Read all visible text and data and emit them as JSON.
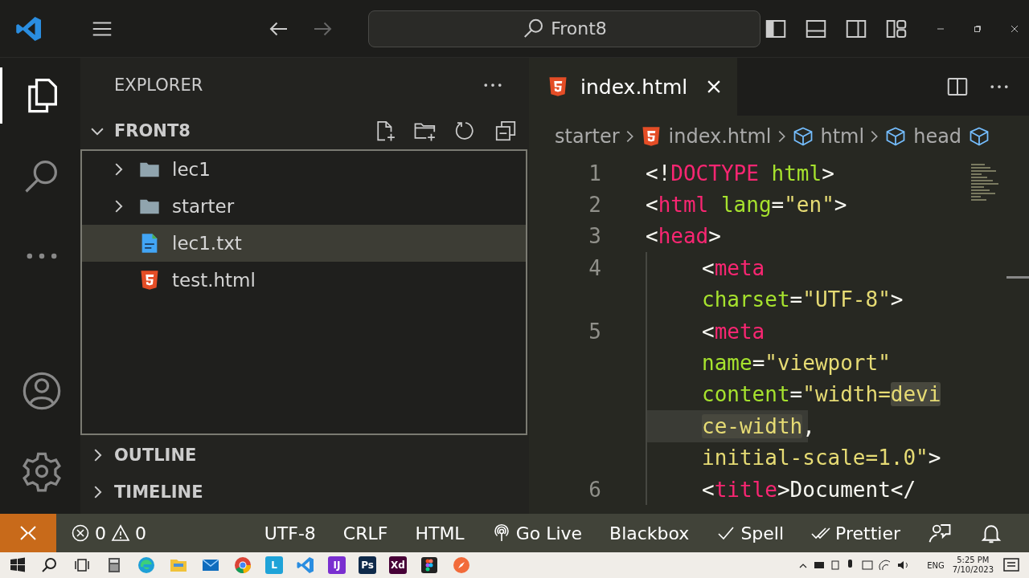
{
  "title_bar": {
    "search": "Front8"
  },
  "activity_bar": [
    {
      "kind": "files",
      "selected": true
    },
    {
      "kind": "search",
      "selected": false
    },
    {
      "kind": "more",
      "selected": false
    }
  ],
  "activity_bottom": [
    {
      "kind": "account"
    },
    {
      "kind": "settings"
    }
  ],
  "sidebar": {
    "title": "EXPLORER",
    "folder": {
      "name": "FRONT8",
      "expanded": true
    },
    "items": [
      {
        "name": "lec1",
        "kind": "folder",
        "expanded": false,
        "selected": false
      },
      {
        "name": "starter",
        "kind": "folder",
        "expanded": false,
        "selected": false
      },
      {
        "name": "lec1.txt",
        "kind": "text-file",
        "selected": true
      },
      {
        "name": "test.html",
        "kind": "html-file",
        "selected": false
      }
    ],
    "sections": [
      {
        "name": "OUTLINE",
        "expanded": false
      },
      {
        "name": "TIMELINE",
        "expanded": false
      }
    ]
  },
  "editor": {
    "tabs": [
      {
        "name": "index.html",
        "selected": true
      }
    ],
    "breadcrumbs": [
      {
        "text": "starter",
        "kind": "folder"
      },
      {
        "text": "index.html",
        "kind": "html"
      },
      {
        "text": "html",
        "kind": "element"
      },
      {
        "text": "head",
        "kind": "element"
      }
    ],
    "lines": [
      {
        "number": "1",
        "indent": false,
        "current": false,
        "tokens": [
          {
            "t": "<!",
            "kind": "punct"
          },
          {
            "t": "DOCTYPE",
            "kind": "tag"
          },
          {
            "t": " html",
            "kind": "attr"
          },
          {
            "t": ">",
            "kind": "punct"
          }
        ]
      },
      {
        "number": "2",
        "indent": false,
        "current": false,
        "tokens": [
          {
            "t": "<",
            "kind": "punct"
          },
          {
            "t": "html",
            "kind": "tag"
          },
          {
            "t": " lang",
            "kind": "attr"
          },
          {
            "t": "=",
            "kind": "punct"
          },
          {
            "t": "\"en\"",
            "kind": "string"
          },
          {
            "t": ">",
            "kind": "punct"
          }
        ]
      },
      {
        "number": "3",
        "indent": false,
        "current": false,
        "tokens": [
          {
            "t": "<",
            "kind": "punct"
          },
          {
            "t": "head",
            "kind": "tag"
          },
          {
            "t": ">",
            "kind": "punct"
          }
        ]
      },
      {
        "number": "4",
        "indent": true,
        "current": false,
        "tokens": [
          {
            "t": "<",
            "kind": "punct"
          },
          {
            "t": "meta",
            "kind": "tag"
          }
        ]
      },
      {
        "indent": true,
        "current": false,
        "tokens": [
          {
            "t": "charset",
            "kind": "attr"
          },
          {
            "t": "=",
            "kind": "punct"
          },
          {
            "t": "\"UTF-8\"",
            "kind": "string"
          },
          {
            "t": ">",
            "kind": "punct"
          }
        ]
      },
      {
        "number": "5",
        "indent": true,
        "current": false,
        "tokens": [
          {
            "t": "<",
            "kind": "punct"
          },
          {
            "t": "meta",
            "kind": "tag"
          }
        ]
      },
      {
        "indent": true,
        "current": false,
        "tokens": [
          {
            "t": "name",
            "kind": "attr"
          },
          {
            "t": "=",
            "kind": "punct"
          },
          {
            "t": "\"viewport\"",
            "kind": "string"
          }
        ]
      },
      {
        "indent": true,
        "current": false,
        "tokens": [
          {
            "t": "content",
            "kind": "attr"
          },
          {
            "t": "=",
            "kind": "punct"
          },
          {
            "t": "\"width=",
            "kind": "string"
          },
          {
            "t": "devi",
            "kind": "string",
            "highlight": true
          }
        ]
      },
      {
        "indent": true,
        "current": true,
        "tokens": [
          {
            "t": "ce-width",
            "kind": "string",
            "highlight": true
          },
          {
            "t": ",",
            "kind": "punct"
          }
        ]
      },
      {
        "indent": true,
        "current": false,
        "tokens": [
          {
            "t": "initial-scale=1.0\"",
            "kind": "string"
          },
          {
            "t": ">",
            "kind": "punct"
          }
        ]
      },
      {
        "number": "6",
        "indent": true,
        "current": false,
        "tokens": [
          {
            "t": "<",
            "kind": "punct"
          },
          {
            "t": "title",
            "kind": "tag"
          },
          {
            "t": ">",
            "kind": "punct"
          },
          {
            "t": "Document",
            "kind": "text"
          },
          {
            "t": "</",
            "kind": "punct"
          }
        ]
      }
    ]
  },
  "status_bar": {
    "errors": "0",
    "warnings": "0",
    "items": [
      {
        "text": "UTF-8",
        "kind": "plain"
      },
      {
        "text": "CRLF",
        "kind": "plain"
      },
      {
        "text": "HTML",
        "kind": "plain"
      },
      {
        "text": "Go Live",
        "kind": "live"
      },
      {
        "text": "Blackbox",
        "kind": "plain"
      },
      {
        "text": "Spell",
        "kind": "check"
      },
      {
        "text": "Prettier",
        "kind": "double-check"
      }
    ]
  },
  "taskbar": {
    "apps": [
      {
        "kind": "calculator"
      },
      {
        "kind": "edge"
      },
      {
        "kind": "folder"
      },
      {
        "kind": "mail"
      },
      {
        "kind": "chrome"
      },
      {
        "kind": "tile",
        "label": "L",
        "color": "#1fa3d8"
      },
      {
        "kind": "vscode"
      },
      {
        "kind": "tile",
        "label": "IJ",
        "color": "#7a2fd0"
      },
      {
        "kind": "tile",
        "label": "Ps",
        "color": "#0f2a4a"
      },
      {
        "kind": "tile",
        "label": "Xd",
        "color": "#470137"
      },
      {
        "kind": "figma"
      },
      {
        "kind": "compass"
      }
    ],
    "language": "ENG",
    "time": "5:25 PM",
    "date": "7/10/2023"
  }
}
